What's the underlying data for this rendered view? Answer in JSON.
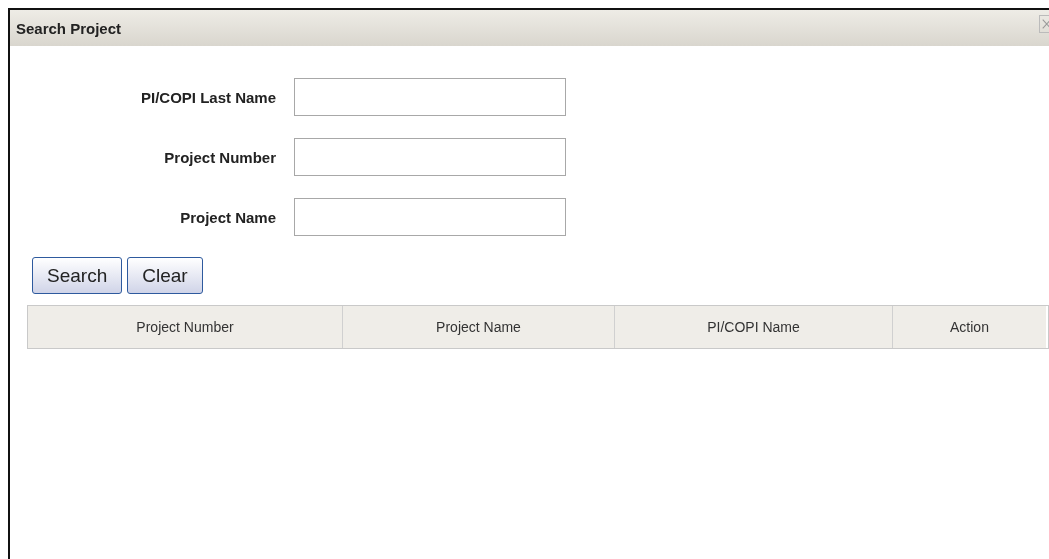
{
  "window": {
    "title": "Search Project"
  },
  "fields": [
    {
      "label": "PI/COPI Last Name"
    },
    {
      "label": "Project Number"
    },
    {
      "label": "Project Name"
    }
  ],
  "buttons": [
    "Search",
    "Clear"
  ],
  "table": {
    "columns": [
      "Project Number",
      "Project Name",
      "PI/COPI Name",
      "Action"
    ]
  }
}
